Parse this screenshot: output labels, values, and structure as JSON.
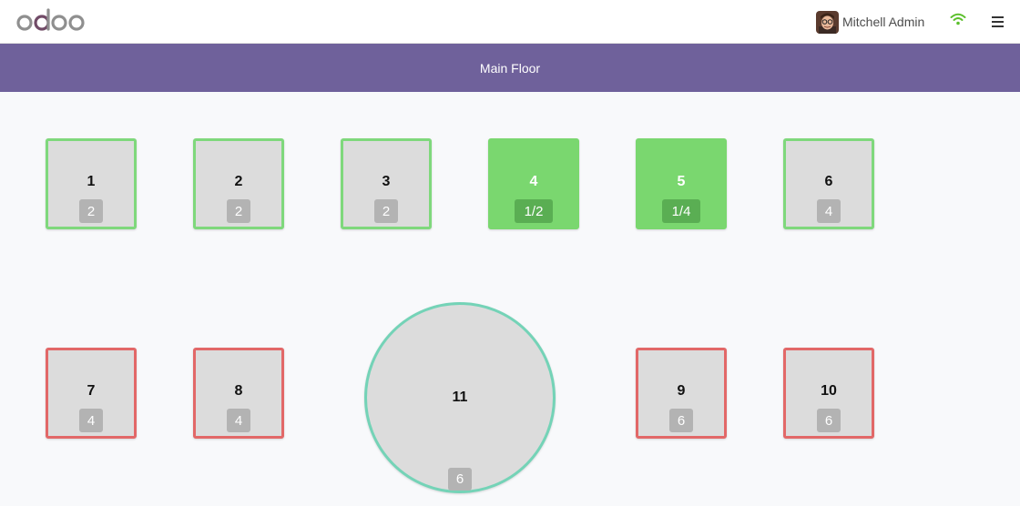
{
  "header": {
    "logo_text": "odoo",
    "user_name": "Mitchell Admin",
    "icons": {
      "avatar": "user-avatar",
      "wifi": "wifi-icon",
      "menu": "hamburger-menu-icon"
    },
    "colors": {
      "brand": "#6f619b",
      "wifi": "#5bbf2b"
    }
  },
  "floor": {
    "name": "Main Floor"
  },
  "tables": [
    {
      "name": "1",
      "seats": "2",
      "status": "available"
    },
    {
      "name": "2",
      "seats": "2",
      "status": "available"
    },
    {
      "name": "3",
      "seats": "2",
      "status": "available"
    },
    {
      "name": "4",
      "seats": "1/2",
      "status": "occupied"
    },
    {
      "name": "5",
      "seats": "1/4",
      "status": "occupied"
    },
    {
      "name": "6",
      "seats": "4",
      "status": "available"
    },
    {
      "name": "7",
      "seats": "4",
      "status": "unavailable"
    },
    {
      "name": "8",
      "seats": "4",
      "status": "unavailable"
    },
    {
      "name": "11",
      "seats": "6",
      "status": "available-round"
    },
    {
      "name": "9",
      "seats": "6",
      "status": "unavailable"
    },
    {
      "name": "10",
      "seats": "6",
      "status": "unavailable"
    }
  ]
}
